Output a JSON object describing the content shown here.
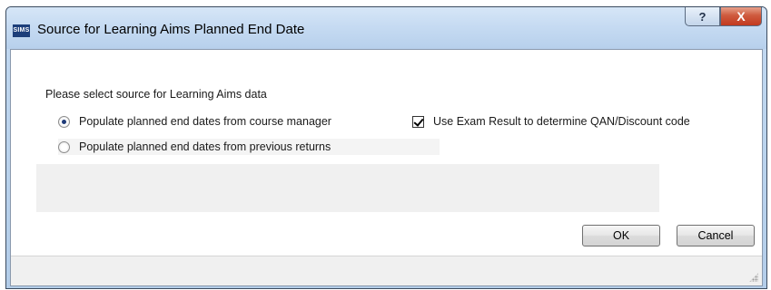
{
  "window": {
    "app_icon_text": "SIMS",
    "title": "Source for Learning Aims Planned End Date",
    "help_label": "?",
    "close_label": "X"
  },
  "form": {
    "group_label": "Please select source for Learning Aims data",
    "options": [
      {
        "label": "Populate planned end dates from course manager",
        "selected": true
      },
      {
        "label": "Populate planned end dates from previous returns",
        "selected": false
      }
    ],
    "checkbox": {
      "label": "Use Exam Result to determine QAN/Discount code",
      "checked": true
    }
  },
  "buttons": {
    "ok_label": "OK",
    "cancel_label": "Cancel"
  }
}
